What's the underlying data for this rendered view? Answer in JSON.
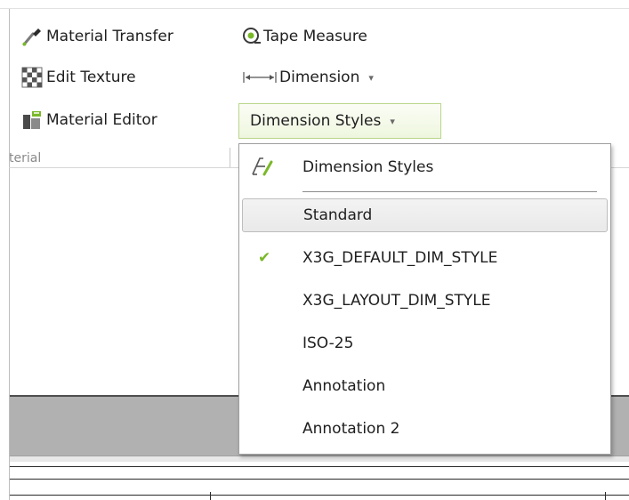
{
  "ribbon": {
    "items": [
      {
        "label": "Material Transfer",
        "icon": "eyedropper-icon"
      },
      {
        "label": "Edit Texture",
        "icon": "checker-texture-icon"
      },
      {
        "label": "Material Editor",
        "icon": "material-editor-icon"
      },
      {
        "label": "Tape Measure",
        "icon": "tape-measure-icon"
      },
      {
        "label": "Dimension",
        "icon": "dimension-icon"
      }
    ],
    "group_label": "terial"
  },
  "dim_styles_button": {
    "label": "Dimension Styles"
  },
  "dropdown": {
    "header": "Dimension Styles",
    "items": [
      {
        "label": "Standard",
        "checked": false,
        "hover": true
      },
      {
        "label": "X3G_DEFAULT_DIM_STYLE",
        "checked": true
      },
      {
        "label": "X3G_LAYOUT_DIM_STYLE",
        "checked": false
      },
      {
        "label": "ISO-25",
        "checked": false
      },
      {
        "label": "Annotation",
        "checked": false
      },
      {
        "label": "Annotation 2",
        "checked": false
      }
    ]
  },
  "colors": {
    "accent_green": "#7ab829",
    "button_border": "#b9d68a"
  }
}
